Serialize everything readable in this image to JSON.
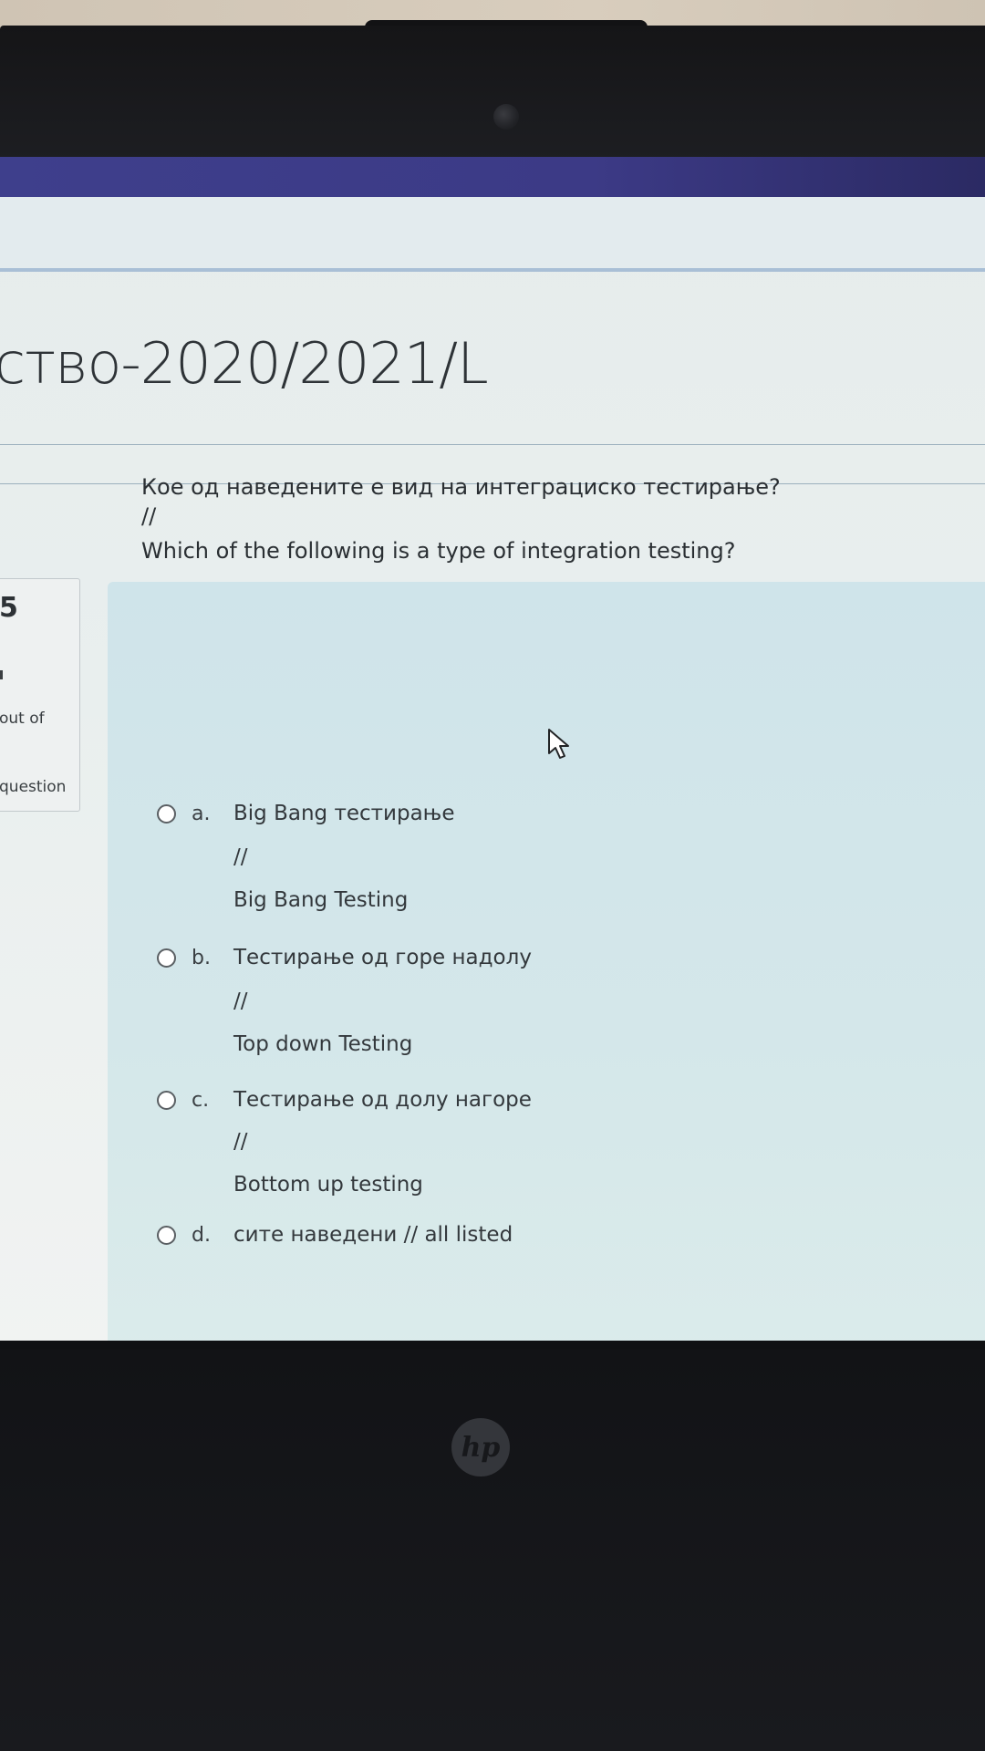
{
  "course": {
    "title": "ство-2020/2021/L"
  },
  "info": {
    "question_number": "5",
    "mark_text": "out of",
    "flag_text": "question"
  },
  "question": {
    "text_mk": "Кое од наведените е вид на интеграциско тестирање?",
    "separator": "//",
    "text_en": "Which of the following is a type of integration testing?"
  },
  "options": [
    {
      "letter": "a.",
      "line1": "Big Bang тестирање",
      "sep": "//",
      "line2": "Big Bang Testing"
    },
    {
      "letter": "b.",
      "line1": "Тестирање од горе надолу",
      "sep": "//",
      "line2": "Top down Testing"
    },
    {
      "letter": "c.",
      "line1": "Тестирање од долу нагоре",
      "sep": "//",
      "line2": "Bottom up testing"
    },
    {
      "letter": "d.",
      "line1": "сите наведени // all listed"
    }
  ],
  "laptop": {
    "brand_logo": "hp"
  },
  "colors": {
    "navbar": "#3e3f8c",
    "question_panel": "#cfe4ea",
    "text": "#2a2f33"
  }
}
